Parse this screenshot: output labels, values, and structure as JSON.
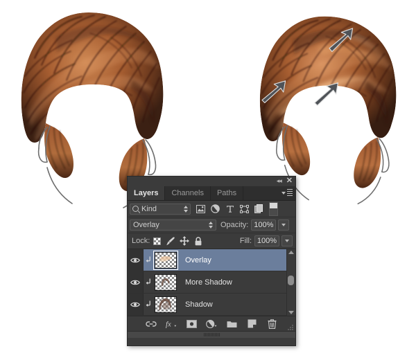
{
  "illustration": {
    "left_figure": {
      "name": "hair-illustration-before",
      "description": "Digital painting of short brown-red hairstyle without highlight overlay"
    },
    "right_figure": {
      "name": "hair-illustration-after",
      "description": "Same hairstyle with overlay highlights added, marked by three arrows",
      "arrow_count": 3,
      "arrow_color": "#4f5358"
    },
    "hair_colors": {
      "dark": "#3a2016",
      "mid": "#8a4a26",
      "light": "#c9804d",
      "highlight": "#e8a873",
      "line": "#241309"
    }
  },
  "panel": {
    "titlebar": {
      "collapse_icon": "collapse-double-arrow-icon",
      "close_icon": "close-icon"
    },
    "tabs": [
      {
        "label": "Layers",
        "active": true
      },
      {
        "label": "Channels",
        "active": false
      },
      {
        "label": "Paths",
        "active": false
      }
    ],
    "panel_menu_icon": "panel-menu-icon",
    "filter_row": {
      "kind_label": "Kind",
      "search_icon": "search-icon",
      "icons": [
        "filter-pixel-layers-icon",
        "filter-adjustment-layers-icon",
        "filter-type-layers-icon",
        "filter-shape-layers-icon",
        "filter-smart-object-icon"
      ],
      "toggle_name": "filter-enable-toggle"
    },
    "blend_row": {
      "blend_mode": "Overlay",
      "opacity_label": "Opacity:",
      "opacity_value": "100%"
    },
    "lock_row": {
      "lock_label": "Lock:",
      "lock_icons": [
        "lock-transparent-pixels-icon",
        "lock-image-pixels-icon",
        "lock-position-icon",
        "lock-all-icon"
      ],
      "fill_label": "Fill:",
      "fill_value": "100%"
    },
    "layers": [
      {
        "name": "Overlay",
        "visible": true,
        "selected": true,
        "clipped": true,
        "thumb": "faint-light-streaks"
      },
      {
        "name": "More Shadow",
        "visible": true,
        "selected": false,
        "clipped": true,
        "thumb": "small-shadow-shape"
      },
      {
        "name": "Shadow",
        "visible": true,
        "selected": false,
        "clipped": true,
        "thumb": "large-shadow-shape"
      }
    ],
    "scrollbar": {
      "up_icon": "scroll-up-icon",
      "down_icon": "scroll-down-icon"
    },
    "footer_buttons": [
      "link-layers-icon",
      "add-layer-style-icon",
      "add-layer-mask-icon",
      "new-adjustment-layer-icon",
      "new-group-icon",
      "new-layer-icon",
      "delete-layer-icon"
    ],
    "resize_grip_icon": "resize-grip-icon"
  },
  "colors": {
    "panel_bg": "#3b3b3b",
    "tab_bg": "#2e2e2e",
    "field_bg": "#454545",
    "selected_row": "#6b7e9c",
    "text": "#c7c7c7"
  }
}
